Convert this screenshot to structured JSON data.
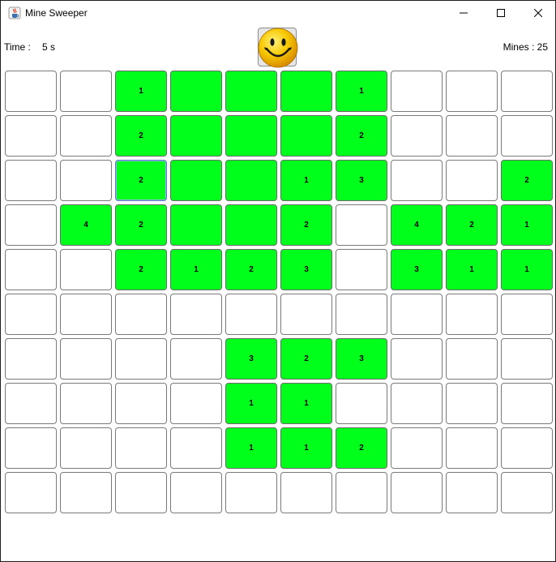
{
  "window": {
    "title": "Mine Sweeper"
  },
  "status": {
    "time_label": "Time :",
    "time_value": "5 s",
    "mines_label": "Mines :",
    "mines_value": "25"
  },
  "smiley": {
    "icon": "smiley-face-icon",
    "face_color": "#f7c800"
  },
  "colors": {
    "revealed": "#00ff1a",
    "hidden": "#ffffff"
  },
  "board": {
    "rows": 10,
    "cols": 10,
    "focused_cell": [
      2,
      2
    ],
    "cells": [
      [
        "h",
        "h",
        "1",
        "",
        "",
        "",
        "1",
        "h",
        "h",
        "h"
      ],
      [
        "h",
        "h",
        "2",
        "",
        "",
        "",
        "2",
        "h",
        "h",
        "h"
      ],
      [
        "h",
        "h",
        "2",
        "",
        "",
        "1",
        "3",
        "h",
        "h",
        "2"
      ],
      [
        "h",
        "4",
        "2",
        "",
        "",
        "2",
        "h",
        "4",
        "2",
        "1"
      ],
      [
        "h",
        "h",
        "2",
        "1",
        "2",
        "3",
        "h",
        "3",
        "1",
        "1"
      ],
      [
        "h",
        "h",
        "h",
        "h",
        "h",
        "h",
        "h",
        "h",
        "h",
        "h"
      ],
      [
        "h",
        "h",
        "h",
        "h",
        "3",
        "2",
        "3",
        "h",
        "h",
        "h"
      ],
      [
        "h",
        "h",
        "h",
        "h",
        "1",
        "1",
        "h",
        "h",
        "h",
        "h"
      ],
      [
        "h",
        "h",
        "h",
        "h",
        "1",
        "1",
        "2",
        "h",
        "h",
        "h"
      ],
      [
        "h",
        "h",
        "h",
        "h",
        "h",
        "h",
        "h",
        "h",
        "h",
        "h"
      ]
    ]
  }
}
